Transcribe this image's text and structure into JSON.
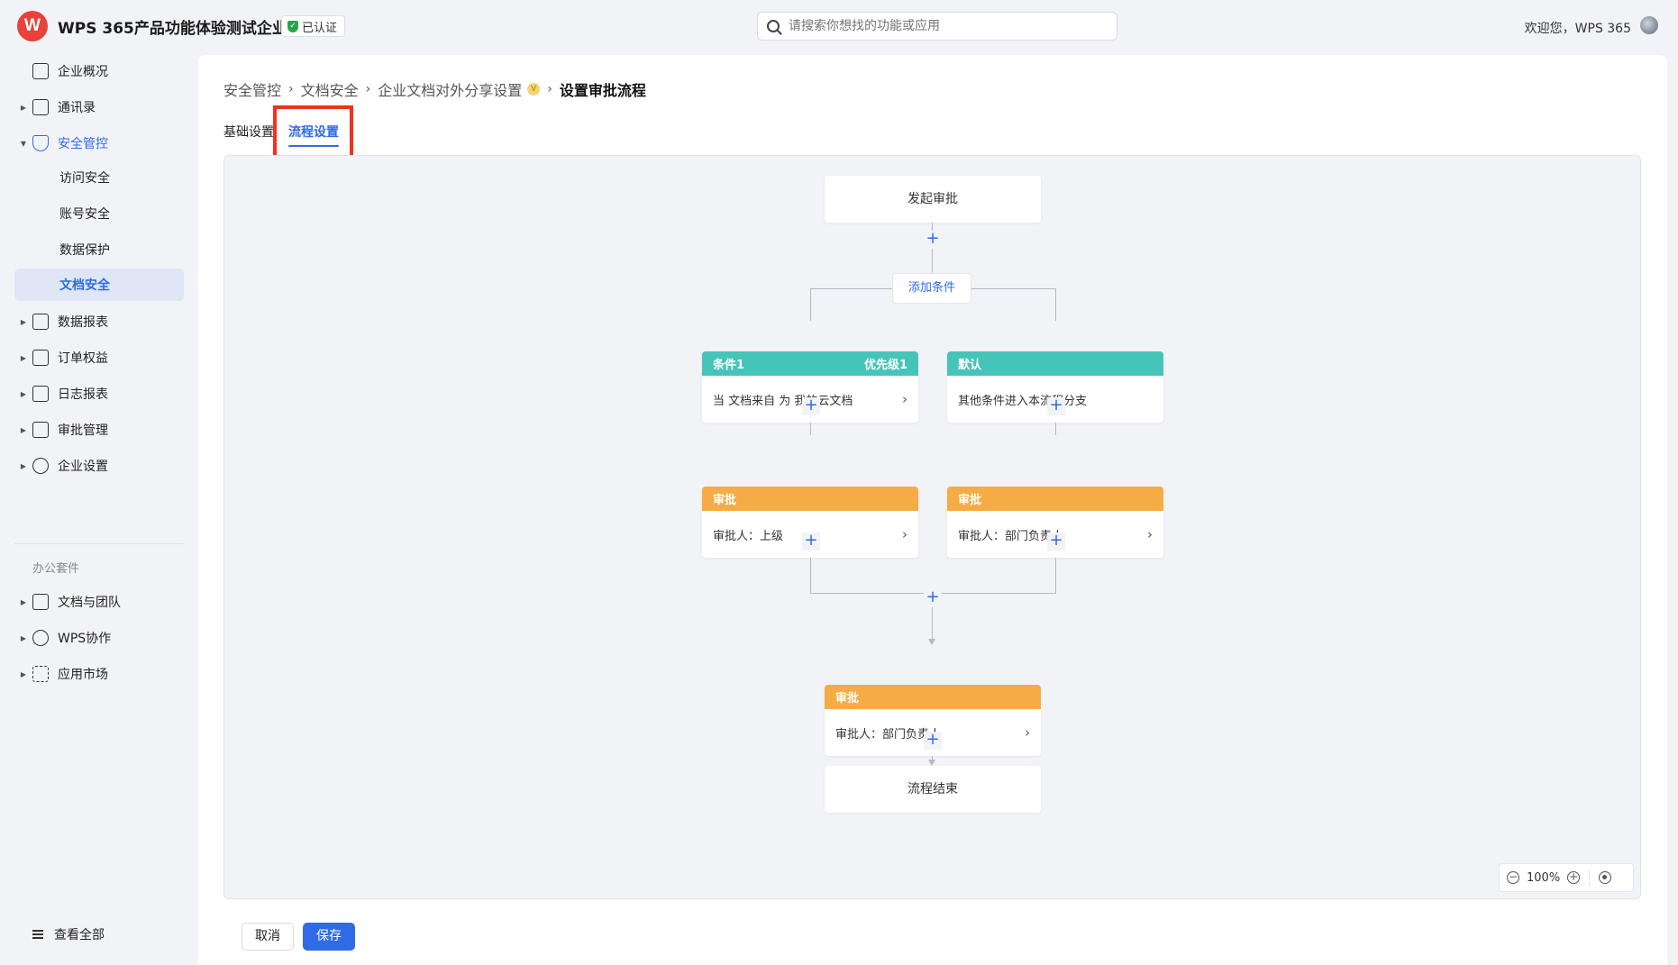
{
  "header": {
    "logo": "W",
    "org_name": "WPS 365产品功能体验测试企业",
    "verified_label": "已认证",
    "search_placeholder": "请搜索你想找的功能或应用",
    "welcome": "欢迎您，WPS 365"
  },
  "sidebar": {
    "items": [
      {
        "label": "企业概况",
        "icon": "building-icon"
      },
      {
        "label": "通讯录",
        "icon": "contacts-icon"
      },
      {
        "label": "安全管控",
        "icon": "shield-icon",
        "expanded": true
      },
      {
        "label": "数据报表",
        "icon": "report-icon"
      },
      {
        "label": "订单权益",
        "icon": "order-icon"
      },
      {
        "label": "日志报表",
        "icon": "log-icon"
      },
      {
        "label": "审批管理",
        "icon": "stamp-icon"
      },
      {
        "label": "企业设置",
        "icon": "gear-icon"
      }
    ],
    "security_sub": [
      "访问安全",
      "账号安全",
      "数据保护",
      "文档安全"
    ],
    "group_label": "办公套件",
    "office_items": [
      {
        "label": "文档与团队",
        "icon": "document-icon"
      },
      {
        "label": "WPS协作",
        "icon": "chat-icon"
      },
      {
        "label": "应用市场",
        "icon": "apps-grid-icon"
      }
    ],
    "view_all": "查看全部"
  },
  "breadcrumb": {
    "items": [
      "安全管控",
      "文档安全",
      "企业文档对外分享设置"
    ],
    "current": "设置审批流程",
    "badge": "V"
  },
  "tabs": [
    "基础设置",
    "流程设置"
  ],
  "flow": {
    "start": "发起审批",
    "add_condition": "添加条件",
    "plus": "+",
    "branches": [
      {
        "cond_title": "条件1",
        "cond_priority": "优先级1",
        "cond_text": "当 文档来自 为 我的云文档",
        "approve_title": "审批",
        "approve_text": "审批人：上级"
      },
      {
        "cond_title": "默认",
        "cond_priority": "",
        "cond_text": "其他条件进入本流程分支",
        "approve_title": "审批",
        "approve_text": "审批人：部门负责人"
      }
    ],
    "merge_title": "审批",
    "merge_text": "审批人：部门负责人",
    "end": "流程结束",
    "chevron": "›"
  },
  "zoom": {
    "level": "100%",
    "minus": "−",
    "plus": "+"
  },
  "actions": {
    "cancel": "取消",
    "save": "保存"
  },
  "colors": {
    "accent": "#2f6be6",
    "condition": "#45c5b9",
    "approval": "#f6ac44",
    "highlight": "#f0321e"
  }
}
